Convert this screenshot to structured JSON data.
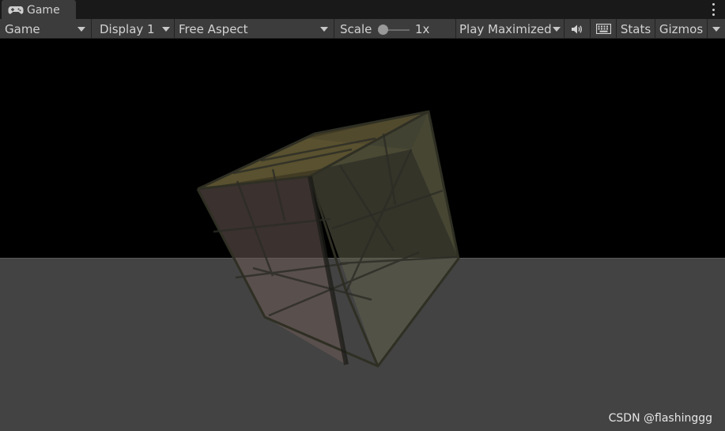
{
  "tab": {
    "title": "Game",
    "icon": "gamepad-icon"
  },
  "toolbar": {
    "mode_dropdown": "Game",
    "display_dropdown": "Display 1",
    "aspect_dropdown": "Free Aspect",
    "scale_label": "Scale",
    "scale_value": "1x",
    "scale_level": 0.0,
    "play_dropdown": "Play Maximized",
    "mute_icon": "speaker-icon",
    "keyboard_icon": "keyboard-icon",
    "stats_label": "Stats",
    "gizmos_label": "Gizmos"
  },
  "viewport": {
    "watermark": "CSDN @flashinggg"
  },
  "colors": {
    "tab_background": "#3c3c3c",
    "toolbar_background": "#3c3c3c",
    "sky": "#000000",
    "ground": "#434343"
  }
}
